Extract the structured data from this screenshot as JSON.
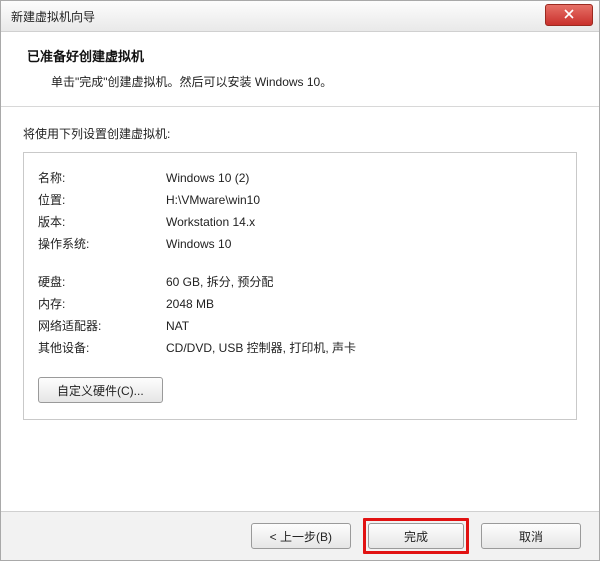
{
  "window": {
    "title": "新建虚拟机向导"
  },
  "header": {
    "title": "已准备好创建虚拟机",
    "subtitle": "单击\"完成\"创建虚拟机。然后可以安装 Windows 10。"
  },
  "intro": "将使用下列设置创建虚拟机:",
  "settings": {
    "name_label": "名称:",
    "name_value": "Windows 10 (2)",
    "location_label": "位置:",
    "location_value": "H:\\VMware\\win10",
    "version_label": "版本:",
    "version_value": "Workstation 14.x",
    "os_label": "操作系统:",
    "os_value": "Windows 10",
    "disk_label": "硬盘:",
    "disk_value": "60 GB, 拆分, 预分配",
    "memory_label": "内存:",
    "memory_value": "2048 MB",
    "net_label": "网络适配器:",
    "net_value": "NAT",
    "other_label": "其他设备:",
    "other_value": "CD/DVD, USB 控制器, 打印机, 声卡"
  },
  "buttons": {
    "customize": "自定义硬件(C)...",
    "back": "< 上一步(B)",
    "finish": "完成",
    "cancel": "取消"
  }
}
